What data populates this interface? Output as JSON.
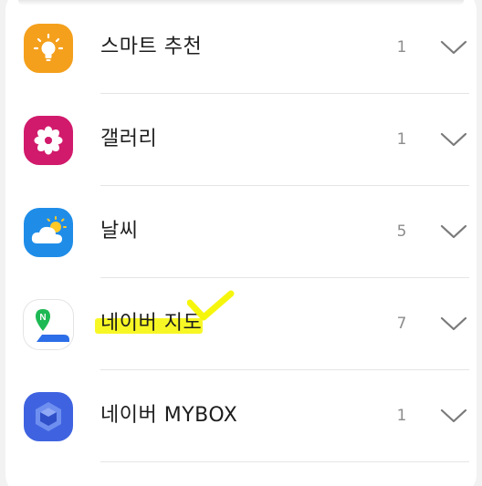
{
  "rows": [
    {
      "label": "스마트 추천",
      "count": "1",
      "icon": "lightbulb-icon",
      "color": "#f4a01c"
    },
    {
      "label": "갤러리",
      "count": "1",
      "icon": "gallery-flower-icon",
      "color": "#d11a6c"
    },
    {
      "label": "날씨",
      "count": "5",
      "icon": "weather-cloud-sun-icon",
      "color": "#1f8de8"
    },
    {
      "label": "네이버 지도",
      "count": "7",
      "icon": "naver-map-icon",
      "color": "#ffffff"
    },
    {
      "label": "네이버 MYBOX",
      "count": "1",
      "icon": "naver-mybox-icon",
      "color": "#3f63e0"
    }
  ],
  "annotation": {
    "highlight_color": "#f6f600"
  }
}
